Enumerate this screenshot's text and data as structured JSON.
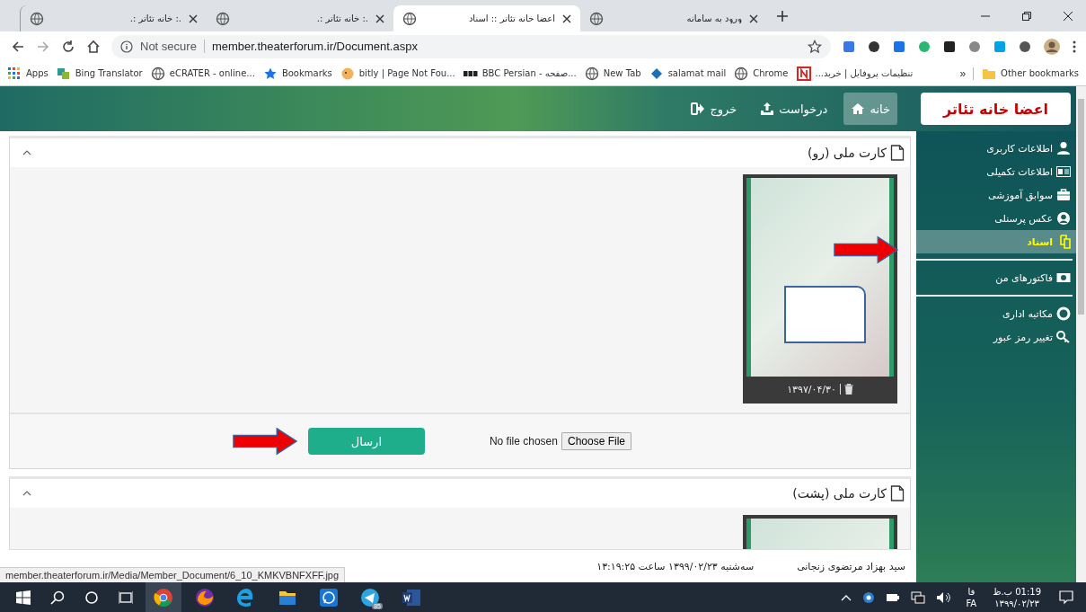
{
  "browser": {
    "tabs": [
      {
        "title": "ورود به سامانه",
        "selected": false
      },
      {
        "title": "اعضا خانه تئاتر :: اسناد",
        "selected": true
      },
      {
        "title": ".: خانه تئاتر :.",
        "selected": false
      },
      {
        "title": ".: خانه تئاتر :.",
        "selected": false
      }
    ],
    "security": "Not secure",
    "url": "member.theaterforum.ir/Document.aspx",
    "bookmarks": [
      {
        "label": "تنظیمات پروفایل | خرید...",
        "kind": "red"
      },
      {
        "label": "Chrome",
        "kind": "globe"
      },
      {
        "label": "salamat mail",
        "kind": "mail"
      },
      {
        "label": "New Tab",
        "kind": "globe"
      },
      {
        "label": "BBC Persian - صفحه...",
        "kind": "bbc"
      },
      {
        "label": "bitly | Page Not Fou...",
        "kind": "bitly"
      },
      {
        "label": "Bookmarks",
        "kind": "star"
      },
      {
        "label": "eCRATER - online...",
        "kind": "globe"
      },
      {
        "label": "Bing Translator",
        "kind": "bing"
      },
      {
        "label": "Apps",
        "kind": "apps"
      }
    ],
    "overflow": "»",
    "other_bookmarks": "Other bookmarks"
  },
  "site": {
    "logo": "اعضا خانه تئاتر",
    "nav": [
      {
        "label": "خانه",
        "kind": "home",
        "selected": true
      },
      {
        "label": "درخواست",
        "kind": "upload",
        "selected": false
      },
      {
        "label": "خروج",
        "kind": "exit",
        "selected": false
      }
    ],
    "sidebar": {
      "groups": [
        [
          {
            "label": "اطلاعات کاربری",
            "kind": "user",
            "selected": false
          },
          {
            "label": "اطلاعات تکمیلی",
            "kind": "card",
            "selected": false
          },
          {
            "label": "سوابق آموزشی",
            "kind": "briefcase",
            "selected": false
          },
          {
            "label": "عکس پرسنلی",
            "kind": "avatar",
            "selected": false
          },
          {
            "label": "اسناد",
            "kind": "docs",
            "selected": true
          }
        ],
        [
          {
            "label": "فاکتورهای من",
            "kind": "money",
            "selected": false
          }
        ],
        [
          {
            "label": "مکاتبه اداری",
            "kind": "lifering",
            "selected": false
          },
          {
            "label": "تغییر رمز عبور",
            "kind": "key",
            "selected": false
          }
        ]
      ]
    },
    "panels": [
      {
        "title": "کارت ملی (رو)",
        "expanded": true,
        "documents": [
          {
            "kind": "image",
            "date": "۱۳۹۷/۰۴/۳۰"
          }
        ],
        "upload": {
          "file_status": "No file chosen",
          "choose_label": "Choose File",
          "submit": "ارسال"
        }
      },
      {
        "title": "کارت ملی (پشت)",
        "expanded": true,
        "documents": [
          {
            "kind": "image"
          }
        ]
      }
    ],
    "footer": {
      "user": "سید بهزاد مرتضوی زنجانی",
      "datetime": "سه‌شنبه ۱۳۹۹/۰۲/۲۳ ساعت ۱۳:۱۹:۲۵"
    }
  },
  "status_link": "member.theaterforum.ir/Media/Member_Document/6_10_KMKVBNFXFF.jpg",
  "taskbar": {
    "telegram_badge": "85",
    "language_short": "فا",
    "language": "FA",
    "time": "01:19 ب.ظ",
    "date": "۱۳۹۹/۰۲/۲۳"
  }
}
